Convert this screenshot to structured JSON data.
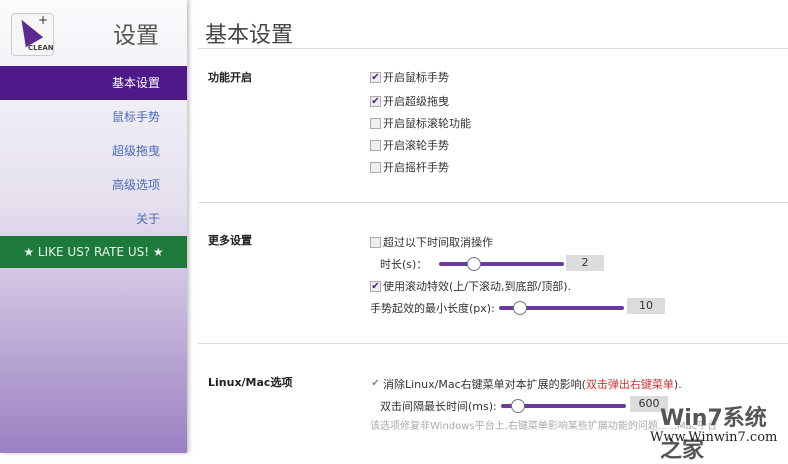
{
  "sidebar": {
    "logo_text": "CLEAN",
    "title": "设置",
    "items": [
      {
        "label": "基本设置"
      },
      {
        "label": "鼠标手势"
      },
      {
        "label": "超级拖曳"
      },
      {
        "label": "高级选项"
      },
      {
        "label": "关于"
      }
    ],
    "rate": "★ LIKE US? RATE US! ★"
  },
  "main": {
    "title": "基本设置",
    "sections": {
      "features": {
        "label": "功能开启",
        "options": [
          {
            "label": "开启鼠标手势",
            "checked": true
          },
          {
            "label": "开启超级拖曳",
            "checked": true
          },
          {
            "label": "开启鼠标滚轮功能",
            "checked": false
          },
          {
            "label": "开启滚轮手势",
            "checked": false
          },
          {
            "label": "开启摇杆手势",
            "checked": false
          }
        ]
      },
      "more": {
        "label": "更多设置",
        "cancel_timeout": {
          "label": "超过以下时间取消操作",
          "checked": false
        },
        "duration": {
          "label": "时长(s)：",
          "value": "2"
        },
        "scroll_effect": {
          "label": "使用滚动特效(上/下滚动,到底部/顶部).",
          "checked": true
        },
        "min_length": {
          "label": "手势起效的最小长度(px):",
          "value": "10"
        }
      },
      "linux": {
        "label": "Linux/Mac选项",
        "fix": {
          "label": "消除Linux/Mac右键菜单对本扩展的影响(",
          "red": "双击弹出右键菜单",
          "tail": ").",
          "checked": true
        },
        "interval": {
          "label": "双击间隔最长时间(ms):",
          "value": "600"
        },
        "help": "该选项修复非Windows平台上,右键菜单影响某些扩展功能的问题......Mac平台"
      }
    }
  },
  "watermark": {
    "name": "Win7系统之家",
    "url": "Www.Winwin7.com"
  }
}
